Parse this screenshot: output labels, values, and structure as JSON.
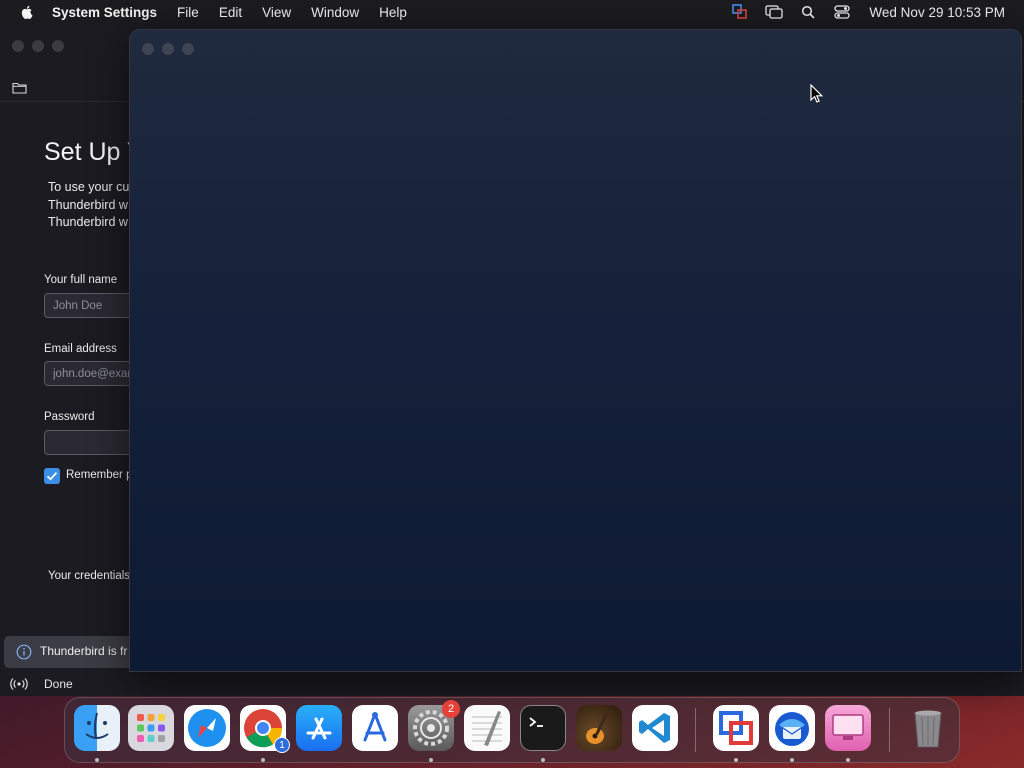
{
  "menubar": {
    "app_name": "System Settings",
    "items": [
      "File",
      "Edit",
      "View",
      "Window",
      "Help"
    ],
    "clock": "Wed Nov 29  10:53 PM"
  },
  "thunderbird": {
    "heading": "Set Up Y",
    "intro_lines": [
      "To use your cu",
      "Thunderbird w",
      "Thunderbird w"
    ],
    "full_name_label": "Your full name",
    "full_name_placeholder": "John Doe",
    "email_label": "Email address",
    "email_placeholder": "john.doe@exan",
    "password_label": "Password",
    "password_value": "",
    "remember_label": "Remember p",
    "remember_checked": true,
    "credentials_text": "Your credentials",
    "notification_text": "Thunderbird is fr",
    "status_text": "Done"
  },
  "dock": {
    "items": [
      {
        "name": "finder",
        "icon": "finder-icon",
        "running": true
      },
      {
        "name": "launchpad",
        "icon": "launchpad-icon",
        "running": false
      },
      {
        "name": "safari",
        "icon": "safari-icon",
        "running": false
      },
      {
        "name": "chrome",
        "icon": "chrome-icon",
        "running": true,
        "badge": "1"
      },
      {
        "name": "app-store",
        "icon": "app-store-icon",
        "running": false
      },
      {
        "name": "xcode-instruments",
        "icon": "instruments-icon",
        "running": false
      },
      {
        "name": "system-settings",
        "icon": "gear-icon",
        "running": true,
        "badge": "2"
      },
      {
        "name": "textedit",
        "icon": "textedit-icon",
        "running": false
      },
      {
        "name": "terminal",
        "icon": "terminal-icon",
        "running": true
      },
      {
        "name": "garageband",
        "icon": "guitar-icon",
        "running": false
      },
      {
        "name": "vscode",
        "icon": "vscode-icon",
        "running": false
      },
      {
        "name": "parallels",
        "icon": "vm-icon",
        "running": true
      },
      {
        "name": "thunderbird",
        "icon": "thunderbird-icon",
        "running": true
      },
      {
        "name": "cleanmymac",
        "icon": "monitor-icon",
        "running": true
      },
      {
        "name": "trash",
        "icon": "trash-icon",
        "running": false
      }
    ]
  },
  "colors": {
    "accent": "#3a8ee6",
    "badge_red": "#e5413a",
    "window_bg": "#1c1b22"
  }
}
